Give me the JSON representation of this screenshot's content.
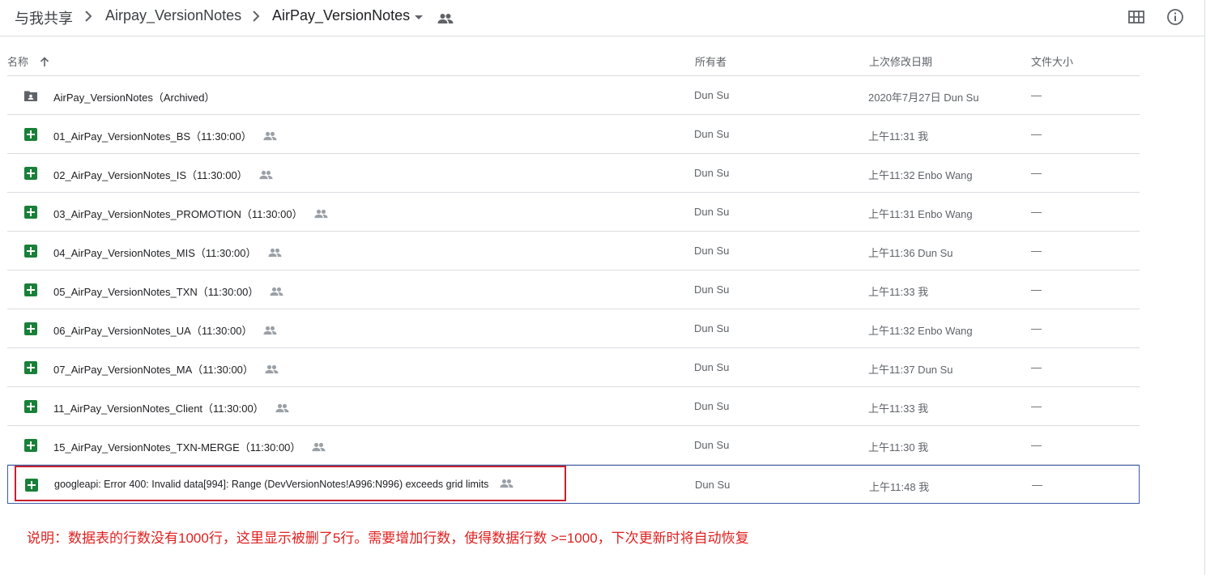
{
  "breadcrumb": {
    "root": "与我共享",
    "parent": "Airpay_VersionNotes",
    "current": "AirPay_VersionNotes"
  },
  "header_icons": [
    "grid-view-icon",
    "info-icon",
    "people-icon",
    "dropdown-arrow-icon"
  ],
  "columns": {
    "name": "名称",
    "owner": "所有者",
    "modified": "上次修改日期",
    "size": "文件大小"
  },
  "files": [
    {
      "name": "AirPay_VersionNotes（Archived）",
      "type": "shared-folder",
      "shared": false,
      "owner": "Dun Su",
      "modified": "2020年7月27日 Dun Su",
      "size": "—"
    },
    {
      "name": "01_AirPay_VersionNotes_BS（11:30:00）",
      "type": "sheet",
      "shared": true,
      "owner": "Dun Su",
      "modified": "上午11:31 我",
      "size": "—"
    },
    {
      "name": "02_AirPay_VersionNotes_IS（11:30:00）",
      "type": "sheet",
      "shared": true,
      "owner": "Dun Su",
      "modified": "上午11:32 Enbo Wang",
      "size": "—"
    },
    {
      "name": "03_AirPay_VersionNotes_PROMOTION（11:30:00）",
      "type": "sheet",
      "shared": true,
      "owner": "Dun Su",
      "modified": "上午11:31 Enbo Wang",
      "size": "—"
    },
    {
      "name": "04_AirPay_VersionNotes_MIS（11:30:00）",
      "type": "sheet",
      "shared": true,
      "owner": "Dun Su",
      "modified": "上午11:36 Dun Su",
      "size": "—"
    },
    {
      "name": "05_AirPay_VersionNotes_TXN（11:30:00）",
      "type": "sheet",
      "shared": true,
      "owner": "Dun Su",
      "modified": "上午11:33 我",
      "size": "—"
    },
    {
      "name": "06_AirPay_VersionNotes_UA（11:30:00）",
      "type": "sheet",
      "shared": true,
      "owner": "Dun Su",
      "modified": "上午11:32 Enbo Wang",
      "size": "—"
    },
    {
      "name": "07_AirPay_VersionNotes_MA（11:30:00）",
      "type": "sheet",
      "shared": true,
      "owner": "Dun Su",
      "modified": "上午11:37 Dun Su",
      "size": "—"
    },
    {
      "name": "11_AirPay_VersionNotes_Client（11:30:00）",
      "type": "sheet",
      "shared": true,
      "owner": "Dun Su",
      "modified": "上午11:33 我",
      "size": "—"
    },
    {
      "name": "15_AirPay_VersionNotes_TXN-MERGE（11:30:00）",
      "type": "sheet",
      "shared": true,
      "owner": "Dun Su",
      "modified": "上午11:30 我",
      "size": "—"
    },
    {
      "name": "googleapi: Error 400: Invalid data[994]: Range (DevVersionNotes!A996:N996) exceeds grid limits",
      "type": "sheet",
      "shared": true,
      "owner": "Dun Su",
      "modified": "上午11:48 我",
      "size": "—",
      "selected": true
    }
  ],
  "annotation_note": "说明：数据表的行数没有1000行，这里显示被删了5行。需要增加行数，使得数据行数 >=1000，下次更新时将自动恢复",
  "colors": {
    "sheets_green": "#188038",
    "folder_gray": "#5f6368",
    "selection_border": "#3b5ba7",
    "annotation_red": "#e02020"
  }
}
